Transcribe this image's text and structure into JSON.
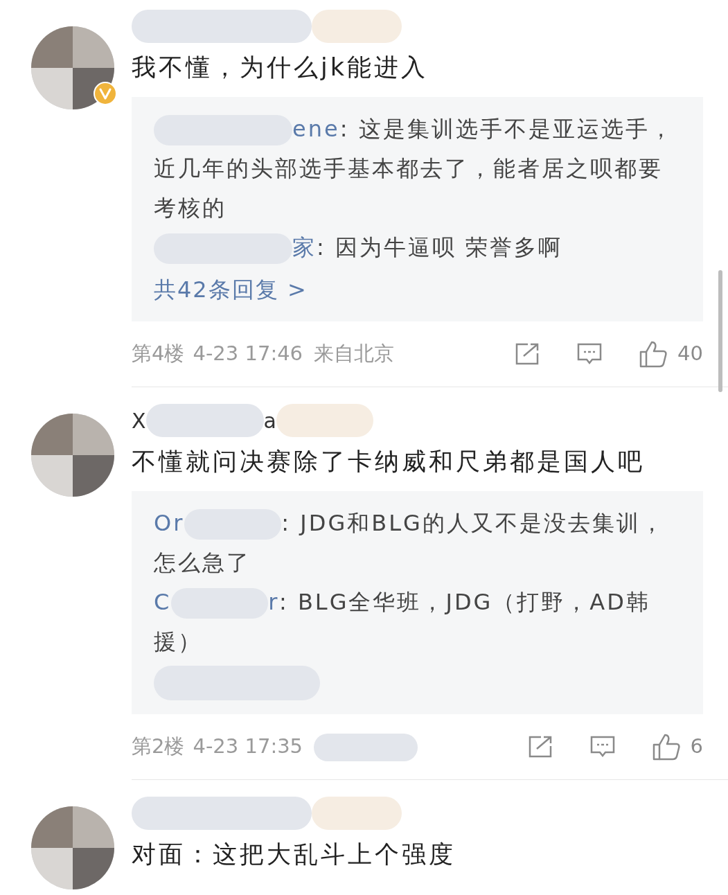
{
  "comments": [
    {
      "verified": true,
      "text": "我不懂，为什么jk能进入",
      "replies": [
        {
          "user_tail": "ene",
          "text": ": 这是集训选手不是亚运选手，近几年的头部选手基本都去了，能者居之呗都要考核的"
        },
        {
          "user_tail": "家",
          "text": ": 因为牛逼呗  荣誉多啊"
        }
      ],
      "more_link": "共42条回复 >",
      "floor": "第4楼",
      "time": "4-23 17:46",
      "location": "来自北京",
      "likes": "40"
    },
    {
      "username_visible": [
        "X",
        "a"
      ],
      "text": "不懂就问决赛除了卡纳威和尺弟都是国人吧",
      "replies": [
        {
          "user_head": "Or",
          "text": ": JDG和BLG的人又不是没去集训，怎么急了"
        },
        {
          "user_head": "C",
          "user_tail": "r",
          "text": ": BLG全华班，JDG（打野，AD韩援）"
        }
      ],
      "more_hidden": true,
      "floor": "第2楼",
      "time": "4-23 17:35",
      "likes": "6"
    },
    {
      "text": "对面：这把大乱斗上个强度"
    }
  ]
}
